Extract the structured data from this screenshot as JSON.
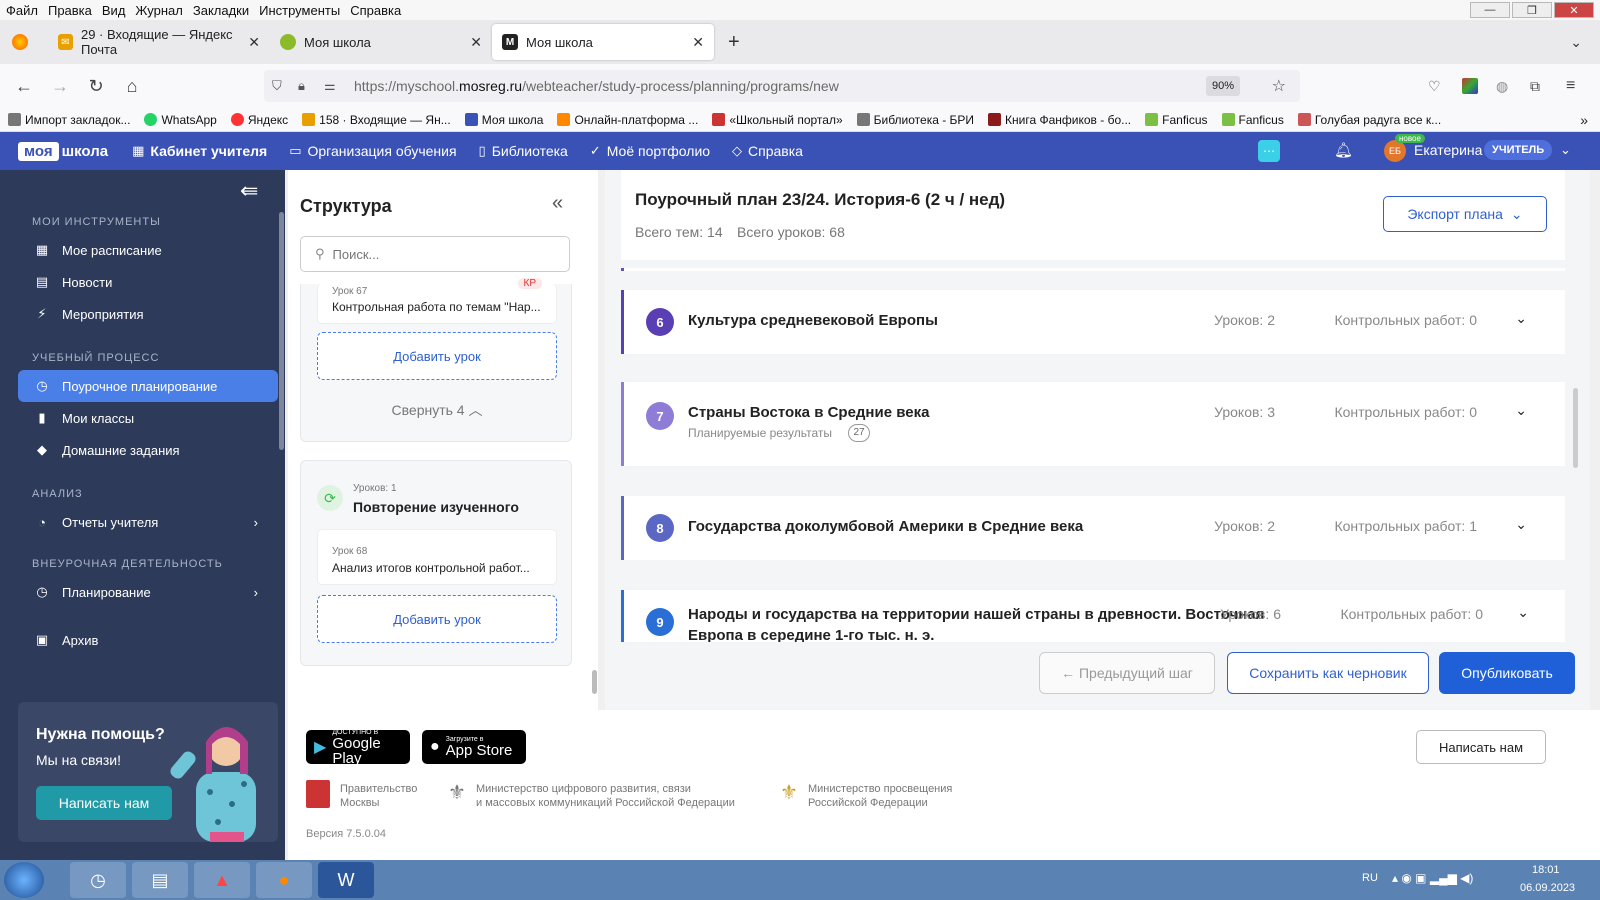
{
  "menubar": [
    "Файл",
    "Правка",
    "Вид",
    "Журнал",
    "Закладки",
    "Инструменты",
    "Справка"
  ],
  "tabs": [
    {
      "label": "29 · Входящие — Яндекс Почта",
      "icon": "yandex-mail-icon",
      "color": "#e8a000",
      "active": false
    },
    {
      "label": "Моя школа",
      "icon": "leaf-icon",
      "color": "#8bbb2b",
      "active": false
    },
    {
      "label": "Моя школа",
      "icon": "myschool-icon",
      "color": "#222",
      "active": true
    }
  ],
  "url": {
    "prefix": "https://myschool.",
    "host": "mosreg.ru",
    "path": "/webteacher/study-process/planning/programs/new",
    "zoom": "90%"
  },
  "bookmarks": [
    {
      "label": "Импорт закладок...",
      "color": "#666"
    },
    {
      "label": "WhatsApp",
      "color": "#25d366"
    },
    {
      "label": "Яндекс",
      "color": "#f33"
    },
    {
      "label": "158 · Входящие — Ян...",
      "color": "#e8a000"
    },
    {
      "label": "Моя школа",
      "color": "#3a52b6"
    },
    {
      "label": "Онлайн-платформа ...",
      "color": "#f80"
    },
    {
      "label": "«Школьный портал»",
      "color": "#c33"
    },
    {
      "label": "Библиотека - БРИ",
      "color": "#777"
    },
    {
      "label": "Книга Фанфиков - бо...",
      "color": "#8b1a1a"
    },
    {
      "label": "Fanficus",
      "color": "#7bc043"
    },
    {
      "label": "Fanficus",
      "color": "#7bc043"
    },
    {
      "label": "Голубая радуга все к...",
      "color": "#c55"
    }
  ],
  "header": {
    "logo_a": "моя",
    "logo_b": "школа",
    "nav": [
      {
        "label": "Кабинет учителя",
        "icon": "grid-icon"
      },
      {
        "label": "Организация обучения",
        "icon": "monitor-icon"
      },
      {
        "label": "Библиотека",
        "icon": "bookmark-icon"
      },
      {
        "label": "Моё портфолио",
        "icon": "check-circle-icon"
      },
      {
        "label": "Справка",
        "icon": "diamond-icon"
      }
    ],
    "user": "Екатерина",
    "avatar": "ЕБ",
    "badge_new": "новое",
    "role": "УЧИТЕЛЬ"
  },
  "sidebar": {
    "sections": [
      {
        "title": "МОИ ИНСТРУМЕНТЫ",
        "items": [
          {
            "label": "Мое расписание",
            "icon": "calendar-icon"
          },
          {
            "label": "Новости",
            "icon": "news-icon"
          },
          {
            "label": "Мероприятия",
            "icon": "lightning-icon"
          }
        ]
      },
      {
        "title": "УЧЕБНЫЙ ПРОЦЕСС",
        "items": [
          {
            "label": "Поурочное планирование",
            "icon": "clock-icon",
            "active": true
          },
          {
            "label": "Мои классы",
            "icon": "book-icon"
          },
          {
            "label": "Домашние задания",
            "icon": "graduation-icon"
          }
        ]
      },
      {
        "title": "АНАЛИЗ",
        "items": [
          {
            "label": "Отчеты учителя",
            "icon": "pie-chart-icon",
            "chevron": true
          }
        ]
      },
      {
        "title": "ВНЕУРОЧНАЯ ДЕЯТЕЛЬНОСТЬ",
        "items": [
          {
            "label": "Планирование",
            "icon": "clock-icon",
            "chevron": true
          }
        ]
      }
    ],
    "archive": "Архив",
    "help": {
      "title": "Нужна помощь?",
      "subtitle": "Мы на связи!",
      "button": "Написать нам"
    }
  },
  "structure": {
    "title": "Структура",
    "search_placeholder": "Поиск...",
    "lesson67": {
      "num": "Урок 67",
      "title": "Контрольная работа по темам \"Нар...",
      "badge": "КР"
    },
    "add_lesson": "Добавить урок",
    "collapse": "Свернуть 4",
    "block": {
      "count": "Уроков: 1",
      "title": "Повторение изученного"
    },
    "lesson68": {
      "num": "Урок 68",
      "title": "Анализ итогов контрольной работ..."
    }
  },
  "plan": {
    "title": "Поурочный план 23/24. История-6 (2 ч / нед)",
    "total_topics": "Всего тем: 14",
    "total_lessons": "Всего уроков: 68",
    "export": "Экспорт плана",
    "topics": [
      {
        "num": "6",
        "title": "Культура средневековой Европы",
        "lessons": "Уроков: 2",
        "tests": "Контрольных работ: 0",
        "color": "#5a3fb4"
      },
      {
        "num": "7",
        "title": "Страны Востока в Средние века",
        "lessons": "Уроков: 3",
        "tests": "Контрольных работ: 0",
        "color": "#8e7cd6",
        "results_label": "Планируемые результаты",
        "results_count": "27"
      },
      {
        "num": "8",
        "title": "Государства доколумбовой Америки в Средние века",
        "lessons": "Уроков: 2",
        "tests": "Контрольных работ: 1",
        "color": "#5a67c4"
      },
      {
        "num": "9",
        "title_line1": "Народы и государства на территории нашей страны в древности. Восточная",
        "title_line2": "Европа в середине 1-го тыс. н. э.",
        "lessons": "Уроков: 6",
        "tests": "Контрольных работ: 0",
        "color": "#2a6fd6"
      }
    ],
    "prev": "← Предыдущий шаг",
    "draft": "Сохранить как черновик",
    "publish": "Опубликовать"
  },
  "footer": {
    "google_small": "ДОСТУПНО В",
    "google": "Google Play",
    "apple_small": "Загрузите в",
    "apple": "App Store",
    "write_us": "Написать нам",
    "gov1": [
      "Правительство",
      "Москвы"
    ],
    "gov2": [
      "Министерство цифрового развития, связи",
      "и массовых коммуникаций Российской Федерации"
    ],
    "gov3": [
      "Министерство просвещения",
      "Российской Федерации"
    ],
    "version": "Версия 7.5.0.04"
  },
  "taskbar": {
    "lang": "RU",
    "time": "18:01",
    "date": "06.09.2023"
  }
}
